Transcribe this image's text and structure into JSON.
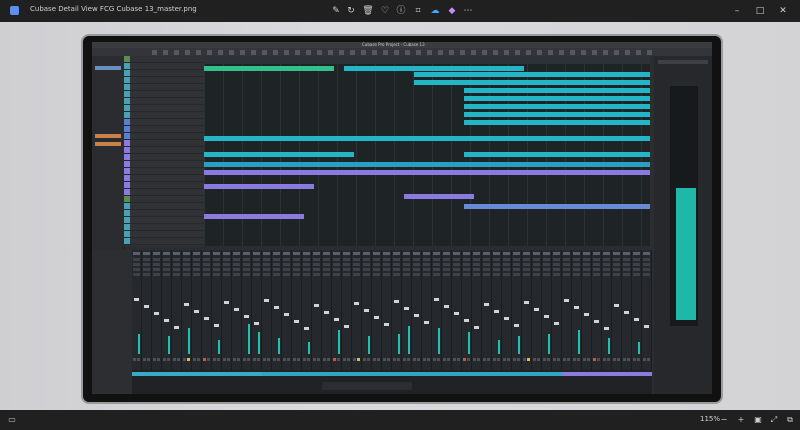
{
  "window": {
    "title": "Cubase Detail View FCG Cubase 13_master.png"
  },
  "toolbar_icons": [
    "edit-icon",
    "rotate-icon",
    "delete-icon",
    "favorite-icon",
    "info-icon",
    "crop-icon",
    "onedrive-icon",
    "copilot-icon",
    "more-icon"
  ],
  "cubase": {
    "project_title": "Cubase Pro Project - Cubase 13"
  },
  "status": {
    "zoom": "115%"
  },
  "bottom_icons": [
    "zoom-out-icon",
    "zoom-in-icon",
    "fit-icon",
    "fullscreen-icon",
    "window-restore-icon"
  ],
  "colors": {
    "accent_teal": "#1fb7a8",
    "clip_cyan": "#23b6c9",
    "clip_purple": "#8b7be0",
    "clip_green": "#33c08a"
  }
}
